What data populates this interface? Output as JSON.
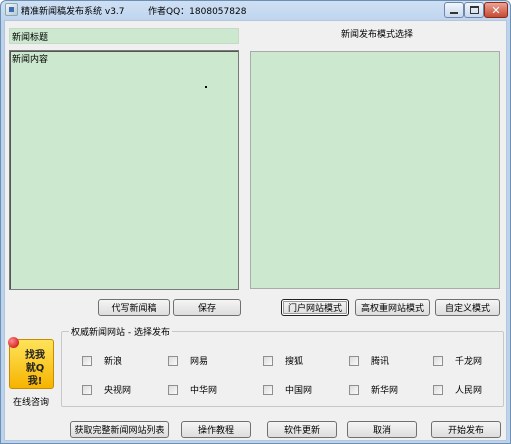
{
  "window": {
    "title": "精准新闻稿发布系统 v3.7",
    "author": "作者QQ：1808057828"
  },
  "editor": {
    "title_field": "新闻标题",
    "content_field": "新闻内容",
    "mode_label": "新闻发布模式选择",
    "write_button": "代写新闻稿",
    "save_button": "保存"
  },
  "modes": {
    "portal": "门户网站模式",
    "high_weight": "高权重网站模式",
    "custom": "自定义模式"
  },
  "group": {
    "label": "权威新闻网站 - 选择发布",
    "sites": [
      "新浪",
      "网易",
      "搜狐",
      "腾讯",
      "千龙网",
      "央视网",
      "中华网",
      "中国网",
      "新华网",
      "人民网"
    ]
  },
  "badge": {
    "line1": "找我",
    "line2": "就Q我!",
    "consult": "在线咨询"
  },
  "footer": {
    "get_list": "获取完整新闻网站列表",
    "tutorial": "操作教程",
    "update": "软件更新",
    "cancel": "取消",
    "publish": "开始发布"
  }
}
